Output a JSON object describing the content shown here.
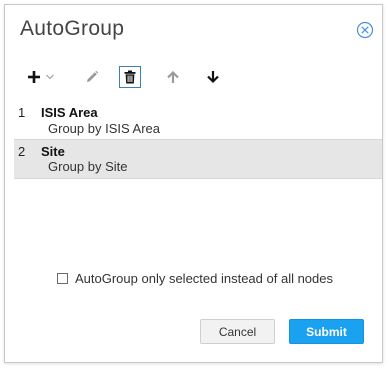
{
  "dialog": {
    "title": "AutoGroup"
  },
  "toolbar": {
    "add_icon": "plus-icon",
    "add_dropdown_icon": "chevron-down-icon",
    "edit_icon": "pencil-icon",
    "delete_icon": "trash-icon",
    "move_up_icon": "arrow-up-icon",
    "move_down_icon": "arrow-down-icon"
  },
  "groups": [
    {
      "index": "1",
      "name": "ISIS Area",
      "description": "Group by ISIS Area",
      "selected": false
    },
    {
      "index": "2",
      "name": "Site",
      "description": "Group by Site",
      "selected": true
    }
  ],
  "options": {
    "selected_only_label": "AutoGroup only selected instead of all nodes",
    "selected_only_checked": false
  },
  "buttons": {
    "cancel_label": "Cancel",
    "submit_label": "Submit"
  },
  "colors": {
    "accent": "#1aa1f0",
    "close_icon": "#4a90d9",
    "selected_row": "#e6e6e6",
    "disabled_icon": "#9a9a9a"
  }
}
